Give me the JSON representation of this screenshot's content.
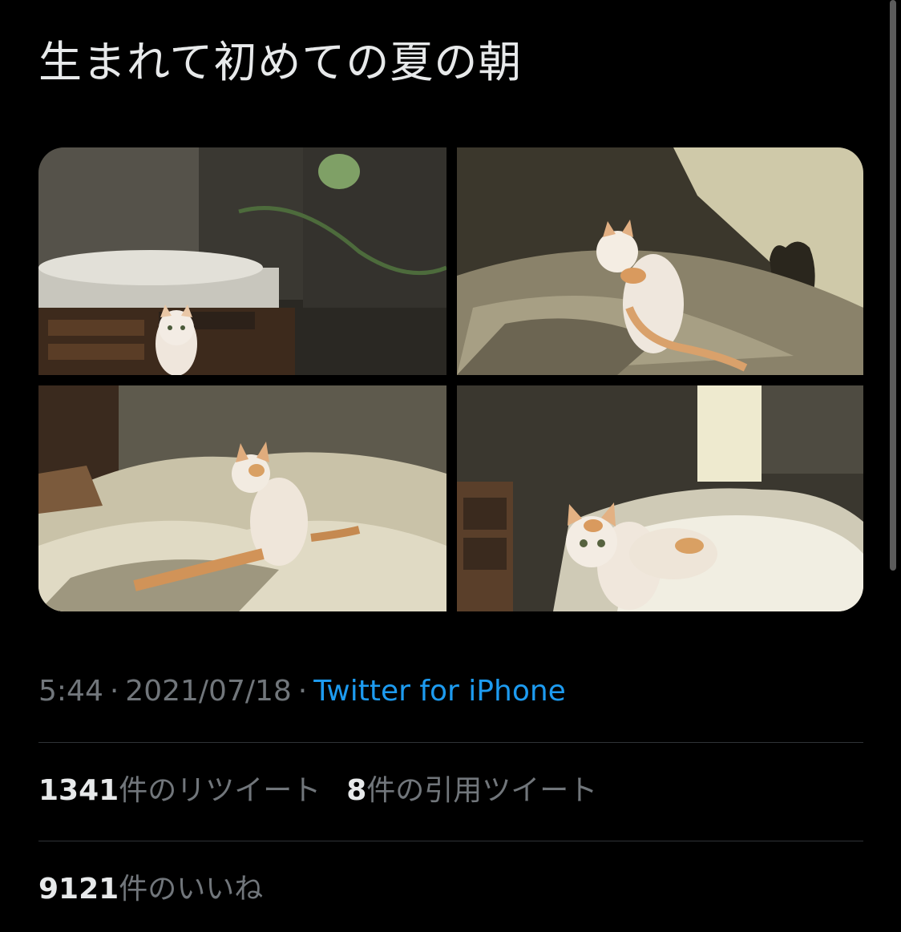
{
  "tweet": {
    "text": "生まれて初めての夏の朝",
    "time": "5:44",
    "date": "2021/07/18",
    "separator": "·",
    "source": "Twitter for iPhone"
  },
  "media": {
    "photos": [
      {
        "description": "kitten sitting in front of bed frame in dim room with plant leaf"
      },
      {
        "description": "kitten on rumpled blanket with its shadow on sunlit wall"
      },
      {
        "description": "kitten looking back on sunlit bed covers"
      },
      {
        "description": "kitten standing on bed in morning sunlight beside shelf"
      }
    ]
  },
  "stats": {
    "retweets": {
      "count": "1341",
      "label": "件のリツイート"
    },
    "quotes": {
      "count": "8",
      "label": "件の引用ツイート"
    },
    "likes": {
      "count": "9121",
      "label": "件のいいね"
    }
  },
  "colors": {
    "background": "#000000",
    "text": "#e7e9ea",
    "secondary": "#71767b",
    "link": "#1d9bf0",
    "divider": "#2f3336"
  }
}
